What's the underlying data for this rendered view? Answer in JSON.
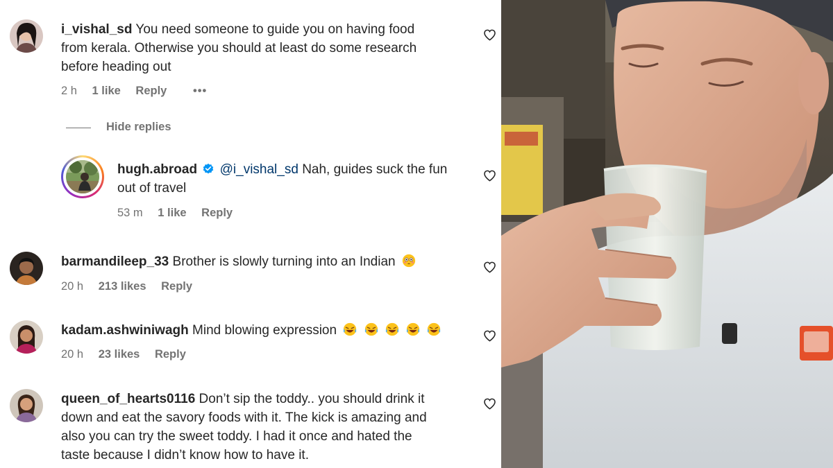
{
  "comments": [
    {
      "username": "i_vishal_sd",
      "text_lines": [
        "You need someone to guide you on having food",
        "from kerala. Otherwise you should at least do some research",
        "before heading out"
      ],
      "time": "2 h",
      "likes": "1 like",
      "reply": "Reply",
      "more": "•••",
      "hide_replies": "Hide replies"
    },
    {
      "username": "hugh.abroad",
      "mention": "@i_vishal_sd",
      "text_line1": "Nah, guides suck the fun",
      "text_line2": "out of travel",
      "time": "53 m",
      "likes": "1 like",
      "reply": "Reply"
    },
    {
      "username": "barmandileep_33",
      "text": "Brother is slowly turning into an Indian",
      "time": "20 h",
      "likes": "213 likes",
      "reply": "Reply"
    },
    {
      "username": "kadam.ashwiniwagh",
      "text": "Mind blowing expression",
      "time": "20 h",
      "likes": "23 likes",
      "reply": "Reply"
    },
    {
      "username": "queen_of_hearts0116",
      "text_lines": [
        "Don’t sip the toddy.. you should drink it",
        "down and eat the savory foods with it. The kick is amazing and",
        "also you can try the sweet toddy. I had it once and hated the",
        "taste because I didn’t know how to have it."
      ]
    }
  ],
  "colors": {
    "verified": "#0095f6",
    "mention": "#00376b",
    "meta": "#737373"
  }
}
